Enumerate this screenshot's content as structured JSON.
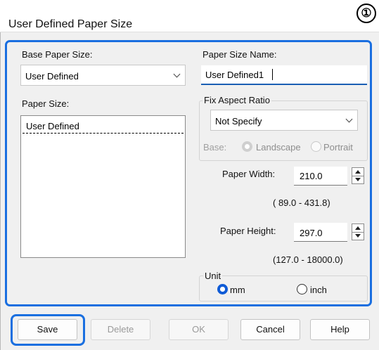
{
  "title": "User Defined Paper Size",
  "step_badge": "①",
  "base_paper_size": {
    "label": "Base Paper Size:",
    "value": "User Defined"
  },
  "paper_size": {
    "label": "Paper Size:",
    "items": [
      "User Defined"
    ]
  },
  "paper_size_name": {
    "label": "Paper Size Name:",
    "value": "User Defined1"
  },
  "fix_aspect_ratio": {
    "label": "Fix Aspect Ratio",
    "value": "Not Specify",
    "base_label": "Base:",
    "landscape": "Landscape",
    "portrait": "Portrait"
  },
  "paper_width": {
    "label": "Paper Width:",
    "value": "210.0",
    "range": "( 89.0 - 431.8)"
  },
  "paper_height": {
    "label": "Paper Height:",
    "value": "297.0",
    "range": "(127.0 - 18000.0)"
  },
  "unit": {
    "label": "Unit",
    "mm": "mm",
    "inch": "inch",
    "selected": "mm"
  },
  "buttons": {
    "save": "Save",
    "delete": "Delete",
    "ok": "OK",
    "cancel": "Cancel",
    "help": "Help"
  },
  "colors": {
    "accent": "#1a6fe0",
    "radio_selected": "#0f5bd6"
  }
}
